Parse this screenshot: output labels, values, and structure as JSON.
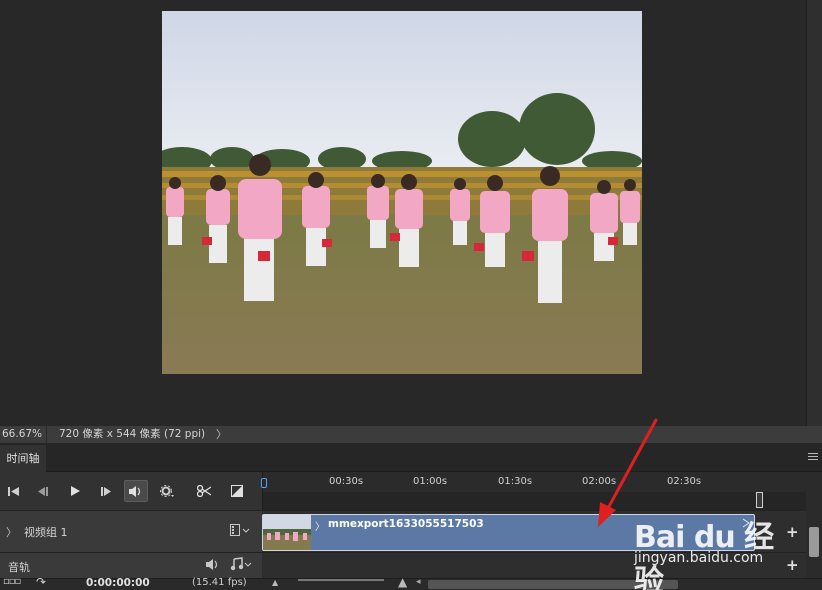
{
  "status_bar": {
    "zoom": "66.67%",
    "doc_info": "720 像素 x 544 像素 (72 ppi)",
    "arrow": "〉"
  },
  "timeline_panel": {
    "tab_label": "时间轴",
    "menu_icon": "panel-menu-icon",
    "controls": [
      {
        "name": "go-to-first-frame-icon",
        "glyph": "⏮"
      },
      {
        "name": "previous-frame-icon",
        "glyph": "◀|"
      },
      {
        "name": "play-icon",
        "glyph": "▶"
      },
      {
        "name": "next-frame-icon",
        "glyph": "|▶"
      },
      {
        "name": "audio-toggle-icon",
        "glyph": "🔊"
      },
      {
        "name": "settings-gear-icon",
        "glyph": "⚙"
      },
      {
        "name": "split-scissors-icon",
        "glyph": "✂"
      },
      {
        "name": "transition-icon",
        "glyph": "◪"
      }
    ],
    "ruler_labels": [
      "00:30s",
      "01:00s",
      "01:30s",
      "02:00s",
      "02:30s"
    ],
    "video_group": {
      "chevron": "〉",
      "label": "视频组 1",
      "clip_name": "mmexport1633055517503",
      "clip_chevron": "〉"
    },
    "audio_track": {
      "label": "音轨"
    },
    "current_time": "0:00:00:00",
    "fps": "(15.41 fps)"
  },
  "watermark": {
    "brand": "Bai du 经验",
    "url": "jingyan.baidu.com"
  },
  "colors": {
    "clip_fill": "#5b79a4",
    "annotation_arrow": "#e02020",
    "playhead": "#5a9cff"
  }
}
